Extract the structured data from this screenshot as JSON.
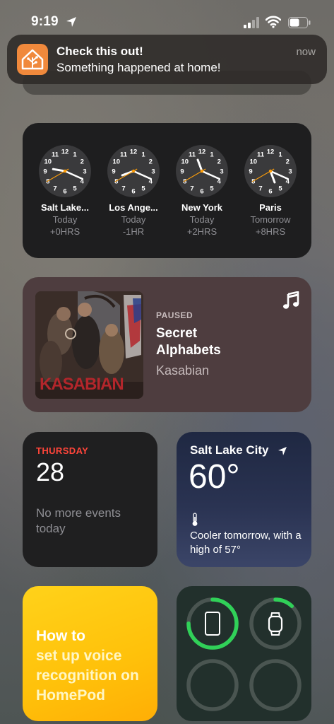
{
  "status_bar": {
    "time": "9:19"
  },
  "notification": {
    "title": "Check this out!",
    "body": "Something happened at home!",
    "time": "now"
  },
  "world_clock": {
    "clocks": [
      {
        "city": "Salt Lake...",
        "day": "Today",
        "offset": "+0HRS"
      },
      {
        "city": "Los Ange...",
        "day": "Today",
        "offset": "-1HR"
      },
      {
        "city": "New York",
        "day": "Today",
        "offset": "+2HRS"
      },
      {
        "city": "Paris",
        "day": "Tomorrow",
        "offset": "+8HRS"
      }
    ],
    "numerals": [
      "12",
      "1",
      "2",
      "3",
      "4",
      "5",
      "6",
      "7",
      "8",
      "9",
      "10",
      "11"
    ]
  },
  "music": {
    "state": "PAUSED",
    "title": "Secret Alphabets",
    "artist": "Kasabian",
    "album_art_text": "KASABIAN"
  },
  "calendar": {
    "day": "THURSDAY",
    "date": "28",
    "events": "No more events today"
  },
  "weather": {
    "city": "Salt Lake City",
    "temp": "60°",
    "forecast": "Cooler tomorrow, with a high of 57°"
  },
  "tips": {
    "line1": "How to",
    "line2": "set up voice recognition on HomePod"
  },
  "batteries": {
    "devices": [
      {
        "name": "iPhone",
        "icon": "iphone-icon",
        "level": 0.75
      },
      {
        "name": "Apple Watch",
        "icon": "watch-icon",
        "level": 0.12
      },
      {
        "name": "",
        "icon": "",
        "level": 0
      },
      {
        "name": "",
        "icon": "",
        "level": 0
      }
    ]
  },
  "colors": {
    "calendar_accent": "#ff453a",
    "battery_green": "#30d158",
    "clock_second_hand": "#ff9f0a"
  }
}
